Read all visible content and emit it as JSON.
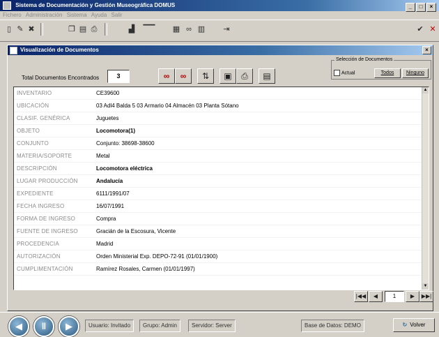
{
  "app": {
    "title": "Sistema de Documentación y Gestión Museográfica DOMUS"
  },
  "menu": [
    "Fichero",
    "Administración",
    "Sistema",
    "Ayuda",
    "Salir"
  ],
  "toolbar_icons": [
    "new-icon",
    "edit-icon",
    "delete-icon",
    "copy-icon",
    "paste-icon",
    "print-icon",
    "image-icon",
    "slider-icon",
    "report-icon",
    "binoculars-icon",
    "table-icon",
    "exit-door-icon",
    "check-icon",
    "close-icon"
  ],
  "child_window": {
    "title": "Visualización de Documentos",
    "total_label": "Total Documentos Encontrados",
    "total_count": "3",
    "selection": {
      "legend": "Selección de Documentos",
      "actual_label": "Actual",
      "todos_label": "Todos",
      "ninguno_label": "Ninguno"
    }
  },
  "record_fields": [
    {
      "label": "INVENTARIO",
      "value": "CE39600",
      "bold": false
    },
    {
      "label": "UBICACIÓN",
      "value": "03 Adl4 Balda 5 03 Armario 04 Almacén 03 Planta Sótano",
      "bold": false
    },
    {
      "label": "CLASIF. GENÉRICA",
      "value": "Juguetes",
      "bold": false
    },
    {
      "label": "OBJETO",
      "value": "Locomotora(1)",
      "bold": true
    },
    {
      "label": "CONJUNTO",
      "value": "Conjunto: 38698-38600",
      "bold": false
    },
    {
      "label": "MATERIA/SOPORTE",
      "value": "Metal",
      "bold": false
    },
    {
      "label": "DESCRIPCIÓN",
      "value": "Locomotora eléctrica",
      "bold": true
    },
    {
      "label": "LUGAR PRODUCCIÓN",
      "value": "Andalucía",
      "bold": true
    },
    {
      "label": "EXPEDIENTE",
      "value": "6111/1991/07",
      "bold": false
    },
    {
      "label": "FECHA INGRESO",
      "value": "16/07/1991",
      "bold": false
    },
    {
      "label": "FORMA DE INGRESO",
      "value": "Compra",
      "bold": false
    },
    {
      "label": "FUENTE DE INGRESO",
      "value": "Gracián de la Escosura, Vicente",
      "bold": false
    },
    {
      "label": "PROCEDENCIA",
      "value": "Madrid",
      "bold": false
    },
    {
      "label": "AUTORIZACIÓN",
      "value": "Orden Ministerial Exp. DEPO-72-91 (01/01/1900)",
      "bold": false
    },
    {
      "label": "CUMPLIMENTACIÓN",
      "value": "Ramírez Rosales, Carmen (01/01/1997)",
      "bold": false
    }
  ],
  "navigation": {
    "current_record": "1"
  },
  "status": {
    "usuario": "Usuario: Invitado",
    "grupo": "Grupo: Admin",
    "servidor": "Servidor: Server",
    "base_datos": "Base de Datos: DEMO",
    "volver_label": "Volver"
  }
}
